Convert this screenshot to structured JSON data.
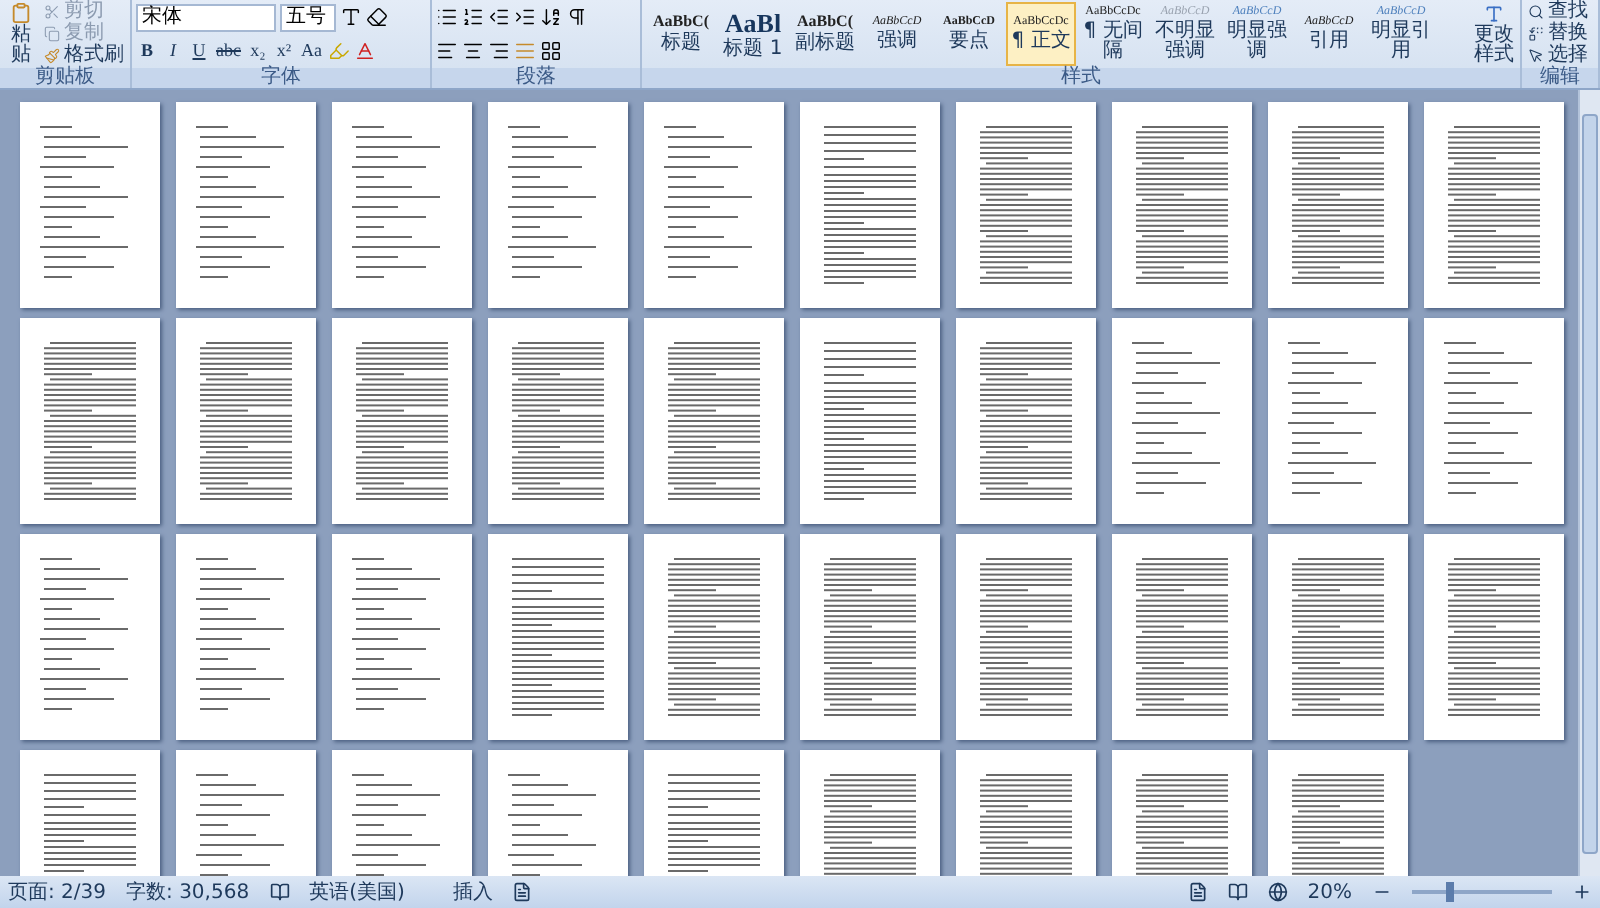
{
  "ribbon": {
    "clipboard": {
      "title": "剪贴板",
      "paste": "粘贴",
      "cut": {
        "label": "剪切",
        "disabled": true
      },
      "copy": {
        "label": "复制",
        "disabled": true
      },
      "format_painter": {
        "label": "格式刷",
        "disabled": false
      }
    },
    "font": {
      "title": "字体",
      "font_name": "宋体",
      "font_size": "五号",
      "buttons": [
        {
          "label": "B",
          "kind": "bold"
        },
        {
          "label": "I",
          "kind": "italic"
        },
        {
          "label": "U",
          "kind": "underline"
        },
        {
          "label": "abc",
          "kind": "strike"
        },
        {
          "label": "x₂",
          "kind": "sub"
        },
        {
          "label": "x²",
          "kind": "sup"
        },
        {
          "label": "Aa",
          "kind": "case"
        }
      ]
    },
    "paragraph": {
      "title": "段落"
    },
    "styles": {
      "title": "样式",
      "items": [
        {
          "sample": "AaBbC(",
          "label": "标题",
          "kind": "heading",
          "selected": false
        },
        {
          "sample": "AaBl",
          "label": "标题 1",
          "kind": "heading1",
          "selected": false
        },
        {
          "sample": "AaBbC(",
          "label": "副标题",
          "kind": "subtitle",
          "selected": false
        },
        {
          "sample": "AaBbCcD",
          "label": "强调",
          "kind": "emphasis",
          "selected": false
        },
        {
          "sample": "AaBbCcD",
          "label": "要点",
          "kind": "strong",
          "selected": false
        },
        {
          "sample": "AaBbCcDc",
          "label": "¶ 正文",
          "kind": "normal",
          "selected": true
        },
        {
          "sample": "AaBbCcDc",
          "label": "¶ 无间隔",
          "kind": "normal",
          "selected": false
        },
        {
          "sample": "AaBbCcD",
          "label": "不明显强调",
          "kind": "subtle",
          "selected": false
        },
        {
          "sample": "AaBbCcD",
          "label": "明显强调",
          "kind": "intense",
          "selected": false
        },
        {
          "sample": "AaBbCcD",
          "label": "引用",
          "kind": "quote",
          "selected": false
        },
        {
          "sample": "AaBbCcD",
          "label": "明显引用",
          "kind": "intensequote",
          "selected": false
        }
      ],
      "change_styles": "更改样式"
    },
    "editing": {
      "title": "编辑",
      "find": "查找",
      "replace": "替换",
      "select": "选择"
    }
  },
  "pages": [
    {
      "kind": "list"
    },
    {
      "kind": "list"
    },
    {
      "kind": "list"
    },
    {
      "kind": "list"
    },
    {
      "kind": "list"
    },
    {
      "kind": "mixed"
    },
    {
      "kind": "prose"
    },
    {
      "kind": "prose"
    },
    {
      "kind": "prose"
    },
    {
      "kind": "prose"
    },
    {
      "kind": "prose"
    },
    {
      "kind": "prose"
    },
    {
      "kind": "prose"
    },
    {
      "kind": "prose"
    },
    {
      "kind": "prose"
    },
    {
      "kind": "mixed"
    },
    {
      "kind": "prose"
    },
    {
      "kind": "list"
    },
    {
      "kind": "list"
    },
    {
      "kind": "list"
    },
    {
      "kind": "list"
    },
    {
      "kind": "list"
    },
    {
      "kind": "list"
    },
    {
      "kind": "mixed"
    },
    {
      "kind": "prose"
    },
    {
      "kind": "prose"
    },
    {
      "kind": "prose"
    },
    {
      "kind": "prose"
    },
    {
      "kind": "prose"
    },
    {
      "kind": "prose"
    },
    {
      "kind": "mixed"
    },
    {
      "kind": "list"
    },
    {
      "kind": "list"
    },
    {
      "kind": "list"
    },
    {
      "kind": "mixed"
    },
    {
      "kind": "prose"
    },
    {
      "kind": "prose"
    },
    {
      "kind": "prose"
    },
    {
      "kind": "prose"
    }
  ],
  "status_bar": {
    "page": "页面: 2/39",
    "words": "字数: 30,568",
    "language": "英语(美国)",
    "mode": "插入",
    "zoom": {
      "label": "20%",
      "level": 0.27
    }
  }
}
